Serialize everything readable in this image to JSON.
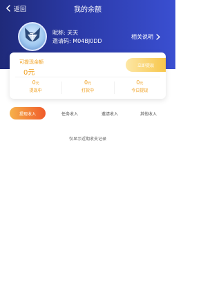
{
  "topbar": {
    "back_label": "返回",
    "title": "我的余额"
  },
  "user": {
    "nickname_label": "昵称:",
    "nickname": "天天",
    "invite_label": "邀请码:",
    "invite_code": "M04BJ0DD",
    "avatar_icon": "fox-avatar-icon"
  },
  "help": {
    "label": "相关说明"
  },
  "balance": {
    "available_label": "可提现余额",
    "available_value": "0元",
    "withdraw_button": "立即提现",
    "stats": [
      {
        "value": "0",
        "unit": "元",
        "label": "提现中"
      },
      {
        "value": "0",
        "unit": "元",
        "label": "打款中"
      },
      {
        "value": "0",
        "unit": "元",
        "label": "今日提现"
      }
    ]
  },
  "tabs": [
    {
      "label": "提现收入",
      "active": true
    },
    {
      "label": "任务收入",
      "active": false
    },
    {
      "label": "邀请收入",
      "active": false
    },
    {
      "label": "其他收入",
      "active": false
    }
  ],
  "hint": "仅显示近期收支记录",
  "colors": {
    "header_start": "#1f2a7a",
    "header_end": "#3a4fd1",
    "accent_orange": "#f0a021",
    "tab_active_start": "#f6b14a",
    "tab_active_end": "#f05a2a"
  }
}
